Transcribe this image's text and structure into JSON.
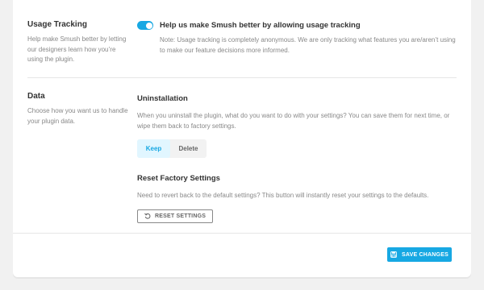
{
  "usage_tracking": {
    "title": "Usage Tracking",
    "description": "Help make Smush better by letting our designers learn how you’re using the plugin.",
    "toggle_label": "Help us make Smush better by allowing usage tracking",
    "toggle_on": true,
    "note": "Note: Usage tracking is completely anonymous. We are only tracking what features you are/aren’t using to make our feature decisions more informed."
  },
  "data": {
    "title": "Data",
    "description": "Choose how you want us to handle your plugin data.",
    "uninstallation": {
      "title": "Uninstallation",
      "description": "When you uninstall the plugin, what do you want to do with your settings? You can save them for next time, or wipe them back to factory settings.",
      "options": [
        "Keep",
        "Delete"
      ],
      "selected": "Keep"
    },
    "reset": {
      "title": "Reset Factory Settings",
      "description": "Need to revert back to the default settings? This button will instantly reset your settings to the defaults.",
      "button_label": "RESET SETTINGS",
      "button_icon": "undo-icon"
    }
  },
  "footer": {
    "save_label": "SAVE CHANGES",
    "save_icon": "save-icon"
  },
  "colors": {
    "accent": "#17a8e3",
    "segment_active_bg": "#e1f6ff"
  }
}
